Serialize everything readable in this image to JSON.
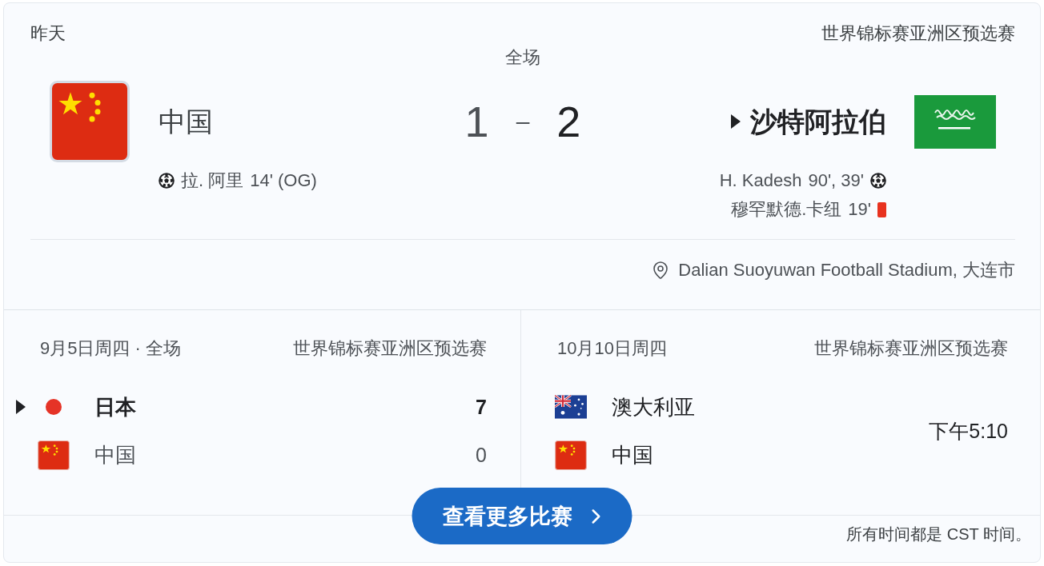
{
  "match": {
    "date": "昨天",
    "competition": "世界锦标赛亚洲区预选赛",
    "status": "全场",
    "home": {
      "name": "中国",
      "flag": {
        "kind": "china"
      },
      "score": "1",
      "winner": false,
      "events": [
        {
          "kind": "goal",
          "player": "拉. 阿里",
          "minute": "14' (OG)"
        }
      ]
    },
    "score_separator": "–",
    "away": {
      "name": "沙特阿拉伯",
      "flag": {
        "kind": "saudi_arabia"
      },
      "score": "2",
      "winner": true,
      "events": [
        {
          "kind": "goal",
          "player": "H. Kadesh",
          "minute": "90', 39'"
        },
        {
          "kind": "red_card",
          "player": "穆罕默德.卡纽",
          "minute": "19'"
        }
      ]
    },
    "venue": "Dalian Suoyuwan Football Stadium, 大连市"
  },
  "other_matches": [
    {
      "date": "9月5日周四 · 全场",
      "competition": "世界锦标赛亚洲区预选赛",
      "teams": [
        {
          "name": "日本",
          "flag": {
            "kind": "japan"
          },
          "score": "7",
          "winner": true
        },
        {
          "name": "中国",
          "flag": {
            "kind": "china"
          },
          "score": "0",
          "winner": false
        }
      ]
    },
    {
      "date": "10月10日周四",
      "competition": "世界锦标赛亚洲区预选赛",
      "time": "下午5:10",
      "teams": [
        {
          "name": "澳大利亚",
          "flag": {
            "kind": "australia"
          }
        },
        {
          "name": "中国",
          "flag": {
            "kind": "china"
          }
        }
      ]
    }
  ],
  "more_button": {
    "label": "查看更多比赛"
  },
  "footer": "所有时间都是 CST 时间。"
}
